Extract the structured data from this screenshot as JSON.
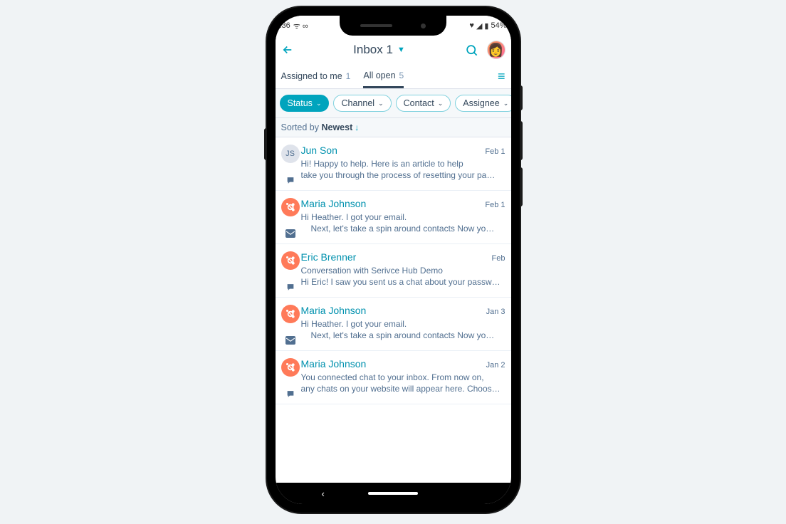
{
  "status_bar": {
    "time": ":36",
    "battery": "54%"
  },
  "header": {
    "title": "Inbox 1"
  },
  "tabs": {
    "assigned": {
      "label": "Assigned to me",
      "count": "1"
    },
    "all_open": {
      "label": "All open",
      "count": "5"
    }
  },
  "filters": {
    "status": "Status",
    "channel": "Channel",
    "contact": "Contact",
    "assignee": "Assignee"
  },
  "sort": {
    "prefix": "Sorted by ",
    "value": "Newest"
  },
  "conversations": [
    {
      "avatar_type": "initials",
      "initials": "JS",
      "name": "Jun Son",
      "date": "Feb 1",
      "line1": "Hi!  Happy to help.  Here is an article to help",
      "line2": "take you through the process of resetting your pa…",
      "channel": "chat"
    },
    {
      "avatar_type": "hubspot",
      "name": "Maria Johnson",
      "date": "Feb 1",
      "line1": "Hi Heather. I got your email.",
      "line2": "Next, let's take a spin around contacts Now yo…",
      "line2_indent": true,
      "channel": "email"
    },
    {
      "avatar_type": "hubspot",
      "name": "Eric Brenner",
      "date": "Feb",
      "line1": "Conversation with Serivce Hub Demo",
      "line2": "Hi Eric! I saw you sent us a chat about your passw…",
      "channel": "chat"
    },
    {
      "avatar_type": "hubspot",
      "name": "Maria Johnson",
      "date": "Jan 3",
      "line1": "Hi Heather. I got your email.",
      "line2": "Next, let's take a spin around contacts Now yo…",
      "line2_indent": true,
      "channel": "email"
    },
    {
      "avatar_type": "hubspot",
      "name": "Maria Johnson",
      "date": "Jan 2",
      "line1": "You connected chat to your inbox. From now on,",
      "line2": "any chats on your website will appear here. Choos…",
      "channel": "chat"
    }
  ]
}
